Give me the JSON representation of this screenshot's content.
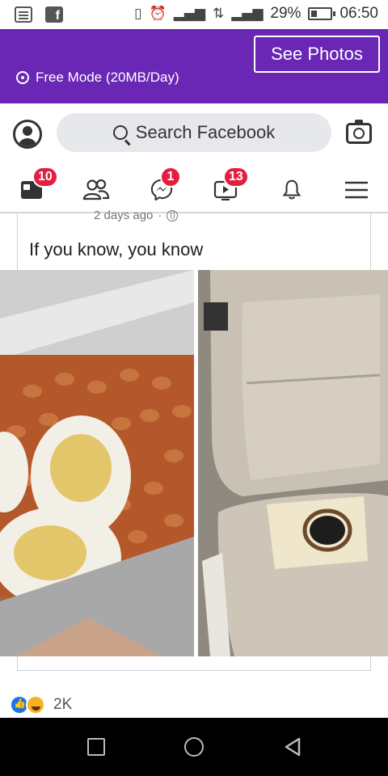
{
  "status_bar": {
    "battery": "29%",
    "time": "06:50",
    "icons": [
      "notes-icon",
      "facebook-app-icon",
      "vibrate-icon",
      "alarm-icon",
      "signal-icon",
      "data-icon",
      "signal-icon-2",
      "battery-icon"
    ]
  },
  "header": {
    "see_photos": "See Photos",
    "free_mode": "Free Mode (20MB/Day)",
    "bg_color": "#6a26b4"
  },
  "search": {
    "placeholder": "Search Facebook"
  },
  "nav": {
    "items": [
      {
        "icon": "home-feed-icon",
        "badge": "10"
      },
      {
        "icon": "friends-icon",
        "badge": ""
      },
      {
        "icon": "messenger-icon",
        "badge": "1"
      },
      {
        "icon": "watch-icon",
        "badge": "13"
      },
      {
        "icon": "notifications-bell-icon",
        "badge": ""
      },
      {
        "icon": "menu-icon",
        "badge": ""
      }
    ]
  },
  "post": {
    "time": "2 days ago",
    "separator": "·",
    "text": "If you know, you know",
    "reaction_count": "2K"
  },
  "colors": {
    "badge": "#e41e3f",
    "like_blue": "#1b74e4"
  }
}
